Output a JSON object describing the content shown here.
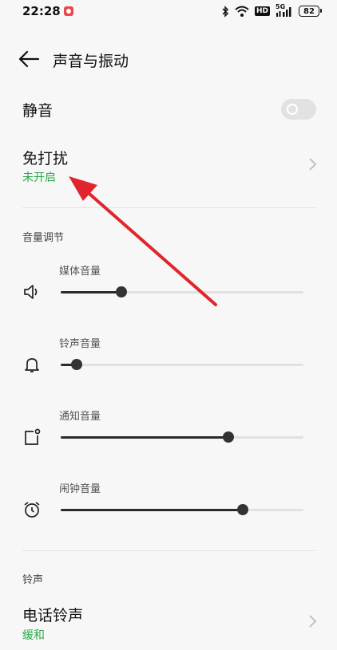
{
  "status_bar": {
    "time": "22:28",
    "battery": "82",
    "network": "5G",
    "hd": "HD"
  },
  "header": {
    "title": "声音与振动"
  },
  "mute": {
    "label": "静音",
    "enabled": false
  },
  "dnd": {
    "label": "免打扰",
    "status": "未开启"
  },
  "volume": {
    "section_title": "音量调节",
    "items": [
      {
        "label": "媒体音量",
        "icon": "speaker-icon",
        "level": 0.25
      },
      {
        "label": "铃声音量",
        "icon": "bell-icon",
        "level": 0.066
      },
      {
        "label": "通知音量",
        "icon": "notification-icon",
        "level": 0.69
      },
      {
        "label": "闹钟音量",
        "icon": "alarm-clock-icon",
        "level": 0.75
      }
    ]
  },
  "ringtone": {
    "section_title": "铃声",
    "phone_ringtone": {
      "label": "电话铃声",
      "value": "缓和"
    }
  },
  "colors": {
    "accent_green": "#2aa84a",
    "annotation_arrow": "#e0262c"
  }
}
